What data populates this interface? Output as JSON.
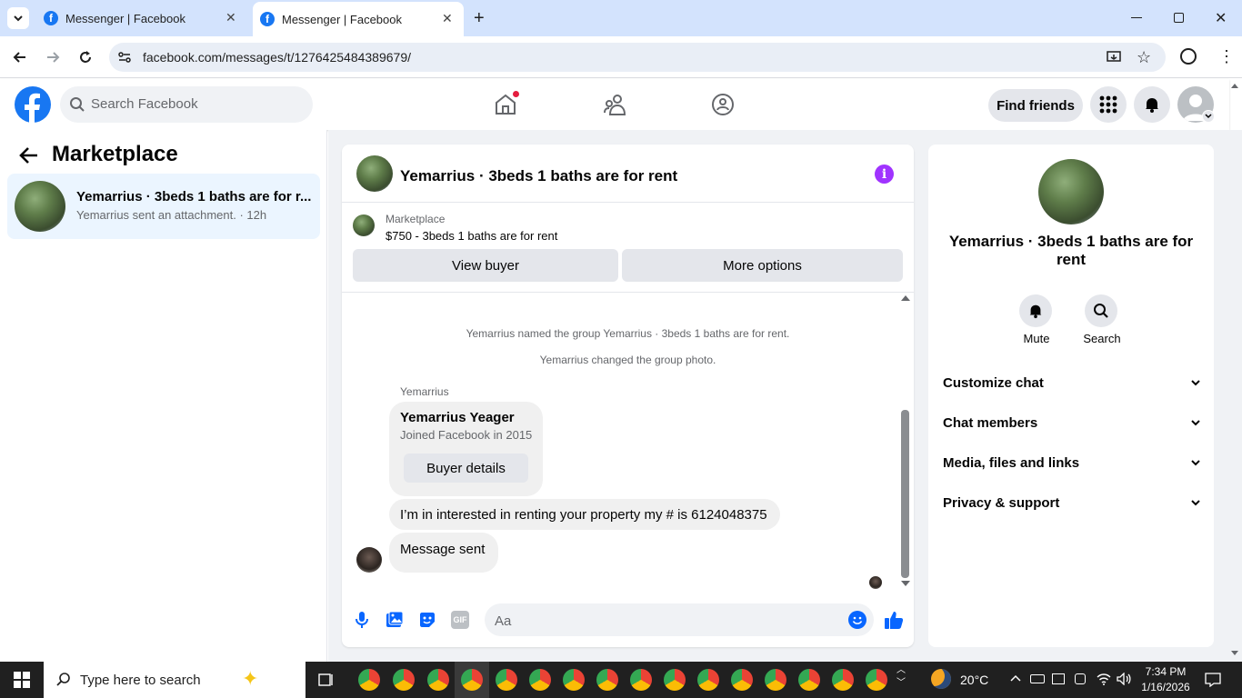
{
  "browser": {
    "tabs": [
      {
        "title": "Messenger | Facebook",
        "active": false
      },
      {
        "title": "Messenger | Facebook",
        "active": true
      }
    ],
    "url": "facebook.com/messages/t/1276425484389679/"
  },
  "fb_nav": {
    "search_placeholder": "Search Facebook",
    "find_friends": "Find friends"
  },
  "left_panel": {
    "title": "Marketplace",
    "conversation": {
      "name": "Yemarrius · 3beds 1 baths are for r...",
      "subtitle": "Yemarrius sent an attachment. · 12h"
    }
  },
  "chat": {
    "title": "Yemarrius · 3beds 1 baths are for rent",
    "marketplace_label": "Marketplace",
    "listing": "$750 - 3beds 1 baths are for rent",
    "view_buyer": "View buyer",
    "more_options": "More options",
    "system_messages": [
      "Yemarrius named the group Yemarrius · 3beds 1 baths are for rent.",
      "Yemarrius changed the group photo."
    ],
    "sender": "Yemarrius",
    "card_name": "Yemarrius Yeager",
    "card_sub": "Joined Facebook in 2015",
    "buyer_details": "Buyer details",
    "message1": "I’m in interested in renting your property my # is 6124048375",
    "message2": "Message sent",
    "composer_placeholder": "Aa",
    "gif_label": "GIF"
  },
  "right_panel": {
    "title": "Yemarrius · 3beds 1 baths are for rent",
    "mute": "Mute",
    "search": "Search",
    "rows": [
      "Customize chat",
      "Chat members",
      "Media, files and links",
      "Privacy & support"
    ]
  },
  "taskbar": {
    "search_placeholder": "Type here to search",
    "temperature": "20°C",
    "time": "7:34 PM",
    "date": "1/16/2026"
  },
  "colors": {
    "fb_blue": "#1877f2",
    "messenger_purple": "#a033ff",
    "selected_conv": "#ebf5ff"
  }
}
